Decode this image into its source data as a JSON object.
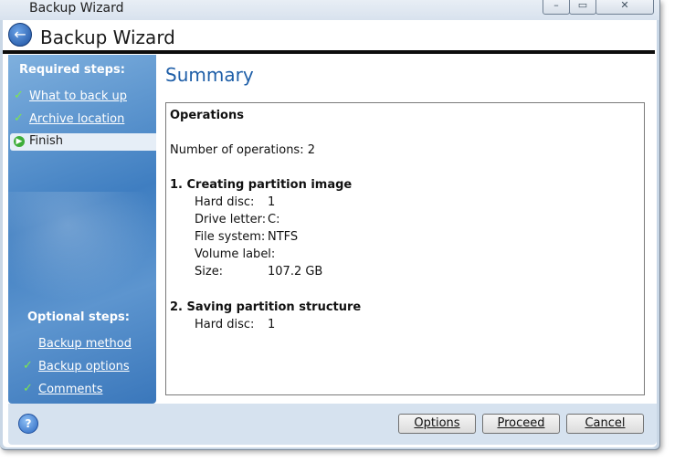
{
  "window": {
    "title": "Backup Wizard",
    "controls": {
      "minimize": "–",
      "maximize": "▭",
      "close": "✕"
    }
  },
  "header": {
    "title": "Backup Wizard",
    "back_icon": "back-arrow-icon"
  },
  "sidebar": {
    "required_heading": "Required steps:",
    "required_steps": [
      {
        "label": "What to back up",
        "done": true
      },
      {
        "label": "Archive location",
        "done": true
      },
      {
        "label": "Finish",
        "current": true
      }
    ],
    "optional_heading": "Optional steps:",
    "optional_steps": [
      {
        "label": "Backup method",
        "done": false
      },
      {
        "label": "Backup options",
        "done": true
      },
      {
        "label": "Comments",
        "done": true
      }
    ]
  },
  "main": {
    "title": "Summary",
    "summary": {
      "heading": "Operations",
      "count_line": "Number of operations: 2",
      "op1_title": "1. Creating partition image",
      "op1": {
        "hard_disc_label": "Hard disc:",
        "hard_disc_value": "1",
        "drive_letter_label": "Drive letter:",
        "drive_letter_value": "C:",
        "file_system_label": "File system:",
        "file_system_value": "NTFS",
        "volume_label_label": "Volume label:",
        "volume_label_value": "",
        "size_label": "Size:",
        "size_value": "107.2 GB"
      },
      "op2_title": "2. Saving partition structure",
      "op2": {
        "hard_disc_label": "Hard disc:",
        "hard_disc_value": "1"
      }
    }
  },
  "footer": {
    "help_icon": "?",
    "options_label": "Options",
    "proceed_label": "Proceed",
    "cancel_label": "Cancel"
  }
}
